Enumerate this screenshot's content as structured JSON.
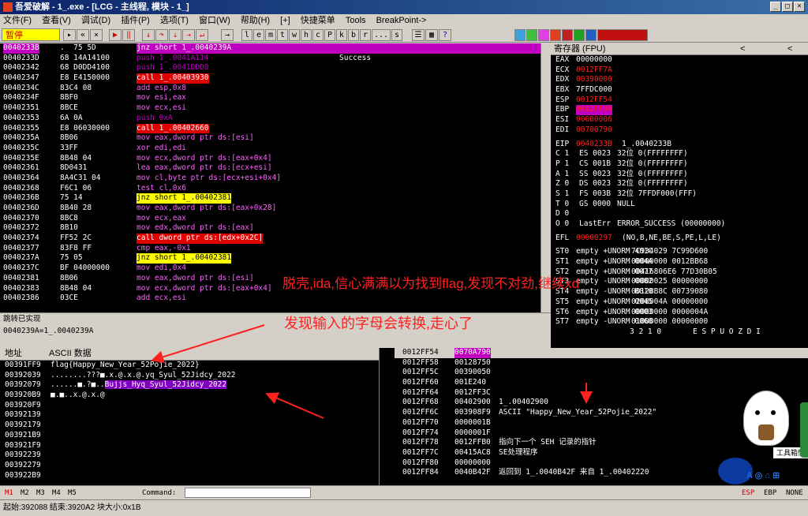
{
  "window": {
    "title": "吾爱破解 - 1_.exe - [LCG - 主线程, 模块 - 1_]"
  },
  "menu": [
    "文件(F)",
    "查看(V)",
    "调试(D)",
    "插件(P)",
    "选项(T)",
    "窗口(W)",
    "帮助(H)",
    "[+]",
    "快捷菜单",
    "Tools",
    "BreakPoint->"
  ],
  "toolbar": {
    "status": "暂停",
    "letters": [
      "l",
      "e",
      "m",
      "t",
      "w",
      "h",
      "c",
      "P",
      "k",
      "b",
      "r",
      "...",
      "s"
    ]
  },
  "disasm": {
    "rows": [
      [
        "0040233B",
        ".  75 5D",
        "jnz short 1_.0040239A",
        ""
      ],
      [
        "0040233D",
        "68 14A14100",
        "push 1_.0041A114",
        "Success"
      ],
      [
        "00402342",
        "68 D0DD4100",
        "push 1_.0041DDD0",
        ""
      ],
      [
        "00402347",
        "E8 E4150000",
        "call 1_.00403930",
        ""
      ],
      [
        "0040234C",
        "83C4 08",
        "add esp,0x8",
        ""
      ],
      [
        "0040234F",
        "8BF0",
        "mov esi,eax",
        ""
      ],
      [
        "00402351",
        "8BCE",
        "mov ecx,esi",
        ""
      ],
      [
        "00402353",
        "6A 0A",
        "push 0xA",
        ""
      ],
      [
        "00402355",
        "E8 06030000",
        "call 1_.00402660",
        ""
      ],
      [
        "0040235A",
        "8B06",
        "mov eax,dword ptr ds:[esi]",
        ""
      ],
      [
        "0040235C",
        "33FF",
        "xor edi,edi",
        ""
      ],
      [
        "0040235E",
        "8B48 04",
        "mov ecx,dword ptr ds:[eax+0x4]",
        ""
      ],
      [
        "00402361",
        "8D0431",
        "lea eax,dword ptr ds:[ecx+esi]",
        ""
      ],
      [
        "00402364",
        "8A4C31 04",
        "mov cl,byte ptr ds:[ecx+esi+0x4]",
        ""
      ],
      [
        "00402368",
        "F6C1 06",
        "test cl,0x6",
        ""
      ],
      [
        "0040236B",
        "75 14",
        "jnz short 1_.00402381",
        ""
      ],
      [
        "0040236D",
        "8B40 28",
        "mov eax,dword ptr ds:[eax+0x28]",
        ""
      ],
      [
        "00402370",
        "8BC8",
        "mov ecx,eax",
        ""
      ],
      [
        "00402372",
        "8B10",
        "mov edx,dword ptr ds:[eax]",
        ""
      ],
      [
        "00402374",
        "FF52 2C",
        "call dword ptr ds:[edx+0x2C]",
        ""
      ],
      [
        "00402377",
        "83F8 FF",
        "cmp eax,-0x1",
        ""
      ],
      [
        "0040237A",
        "75 05",
        "jnz short 1_.00402381",
        ""
      ],
      [
        "0040237C",
        "BF 04000000",
        "mov edi,0x4",
        ""
      ],
      [
        "00402381",
        "8B06",
        "mov eax,dword ptr ds:[esi]",
        ""
      ],
      [
        "00402383",
        "8B48 04",
        "mov ecx,dword ptr ds:[eax+0x4]",
        ""
      ],
      [
        "00402386",
        "03CE",
        "add ecx,esi",
        ""
      ]
    ],
    "info": [
      "跳转已实现",
      "0040239A=1_.0040239A"
    ]
  },
  "registers": {
    "header": "寄存器 (FPU)",
    "rows": [
      [
        "EAX",
        "00000000",
        ""
      ],
      [
        "ECX",
        "0012FF7A",
        ""
      ],
      [
        "EDX",
        "00390000",
        ""
      ],
      [
        "EBX",
        "7FFDC000",
        ""
      ],
      [
        "ESP",
        "0012FF54",
        ""
      ],
      [
        "EBP",
        "0012FF94",
        ""
      ],
      [
        "ESI",
        "00000006",
        ""
      ],
      [
        "EDI",
        "00700790",
        ""
      ],
      [
        "EIP",
        "0040233B",
        "1_.0040233B"
      ],
      [
        "C 1",
        "ES 0023",
        "32位 0(FFFFFFFF)"
      ],
      [
        "P 1",
        "CS 001B",
        "32位 0(FFFFFFFF)"
      ],
      [
        "A 1",
        "SS 0023",
        "32位 0(FFFFFFFF)"
      ],
      [
        "Z 0",
        "DS 0023",
        "32位 0(FFFFFFFF)"
      ],
      [
        "S 1",
        "FS 003B",
        "32位 7FFDF000(FFF)"
      ],
      [
        "T 0",
        "GS 0000",
        "NULL"
      ],
      [
        "D 0",
        "",
        ""
      ],
      [
        "O 0",
        "LastErr",
        "ERROR_SUCCESS (00000000)"
      ],
      [
        "EFL",
        "00000297",
        "(NO,B,NE,BE,S,PE,L,LE)"
      ],
      [
        "ST0",
        "empty +UNORM 401C",
        "7C934029 7C99D600"
      ],
      [
        "ST1",
        "empty +UNORM 004A",
        "00000000 0012BB68"
      ],
      [
        "ST2",
        "empty +UNORM 0077",
        "00416806E6 77D30B05"
      ],
      [
        "ST3",
        "empty -UNORM 0082",
        "00000025 00000000"
      ],
      [
        "ST4",
        "empty -UNORM B810",
        "0012BB8C 00739080"
      ],
      [
        "ST5",
        "empty +UNORM 0045",
        "0208004A 00000000"
      ],
      [
        "ST6",
        "empty +UNORM 0003",
        "00000000 0000004A"
      ],
      [
        "ST7",
        "empty -UNORM 0068",
        "01000000 00000000"
      ],
      [
        "",
        "3 2 1 0",
        "E S P U O Z D I"
      ]
    ]
  },
  "dump": {
    "col1": "地址",
    "col2": "ASCII 数据",
    "rows": [
      [
        "00391FF9",
        "flag{Happy_New_Year_52Pojie_2022}"
      ],
      [
        "00392039",
        "........???■.x.@.x.@.yq_Syul_52Jidcy_2022"
      ],
      [
        "00392079",
        "......■.?■..Bujjs_Hyq_Syul_52Jidcy_2022"
      ],
      [
        "003920B9",
        "■.■..x.@.x.@"
      ],
      [
        "003920F9",
        ""
      ],
      [
        "00392139",
        ""
      ],
      [
        "00392179",
        ""
      ],
      [
        "003921B9",
        ""
      ],
      [
        "003921F9",
        ""
      ],
      [
        "00392239",
        ""
      ],
      [
        "00392279",
        ""
      ],
      [
        "003922B9",
        ""
      ]
    ]
  },
  "stack": {
    "top_addr": "0012FF54",
    "top_val": "0070A790",
    "rows": [
      [
        "0012FF58",
        "00128750",
        ""
      ],
      [
        "0012FF5C",
        "00390050",
        ""
      ],
      [
        "0012FF60",
        "001E240",
        ""
      ],
      [
        "0012FF64",
        "0012FF3C",
        ""
      ],
      [
        "0012FF68",
        "00402900",
        "1_.00402900"
      ],
      [
        "0012FF6C",
        "003908F9",
        "ASCII \"Happy_New_Year_52Pojie_2022\""
      ],
      [
        "0012FF70",
        "0000001B",
        ""
      ],
      [
        "0012FF74",
        "0000001F",
        ""
      ],
      [
        "0012FF78",
        "0012FFB0",
        "指向下一个 SEH 记录的指针"
      ],
      [
        "0012FF7C",
        "00415AC8",
        "SE处理程序"
      ],
      [
        "0012FF80",
        "00000000",
        ""
      ],
      [
        "0012FF84",
        "0040B42F",
        "返回到 1_.0040B42F 来自 1_.00402220"
      ]
    ]
  },
  "annotations": {
    "a1": "脱壳,ida,信心满满以为找到flag,发现不对劲,继续xd",
    "a2": "发现输入的字母会转换,走心了"
  },
  "bottombar": {
    "tabs": [
      "M1",
      "M2",
      "M3",
      "M4",
      "M5"
    ],
    "command_label": "Command:",
    "status": "起始:392088 结束:3920A2 块大小:0x1B",
    "regs": [
      "ESP",
      "EBP",
      "NONE"
    ]
  },
  "widget": {
    "label": "工具箱快"
  }
}
